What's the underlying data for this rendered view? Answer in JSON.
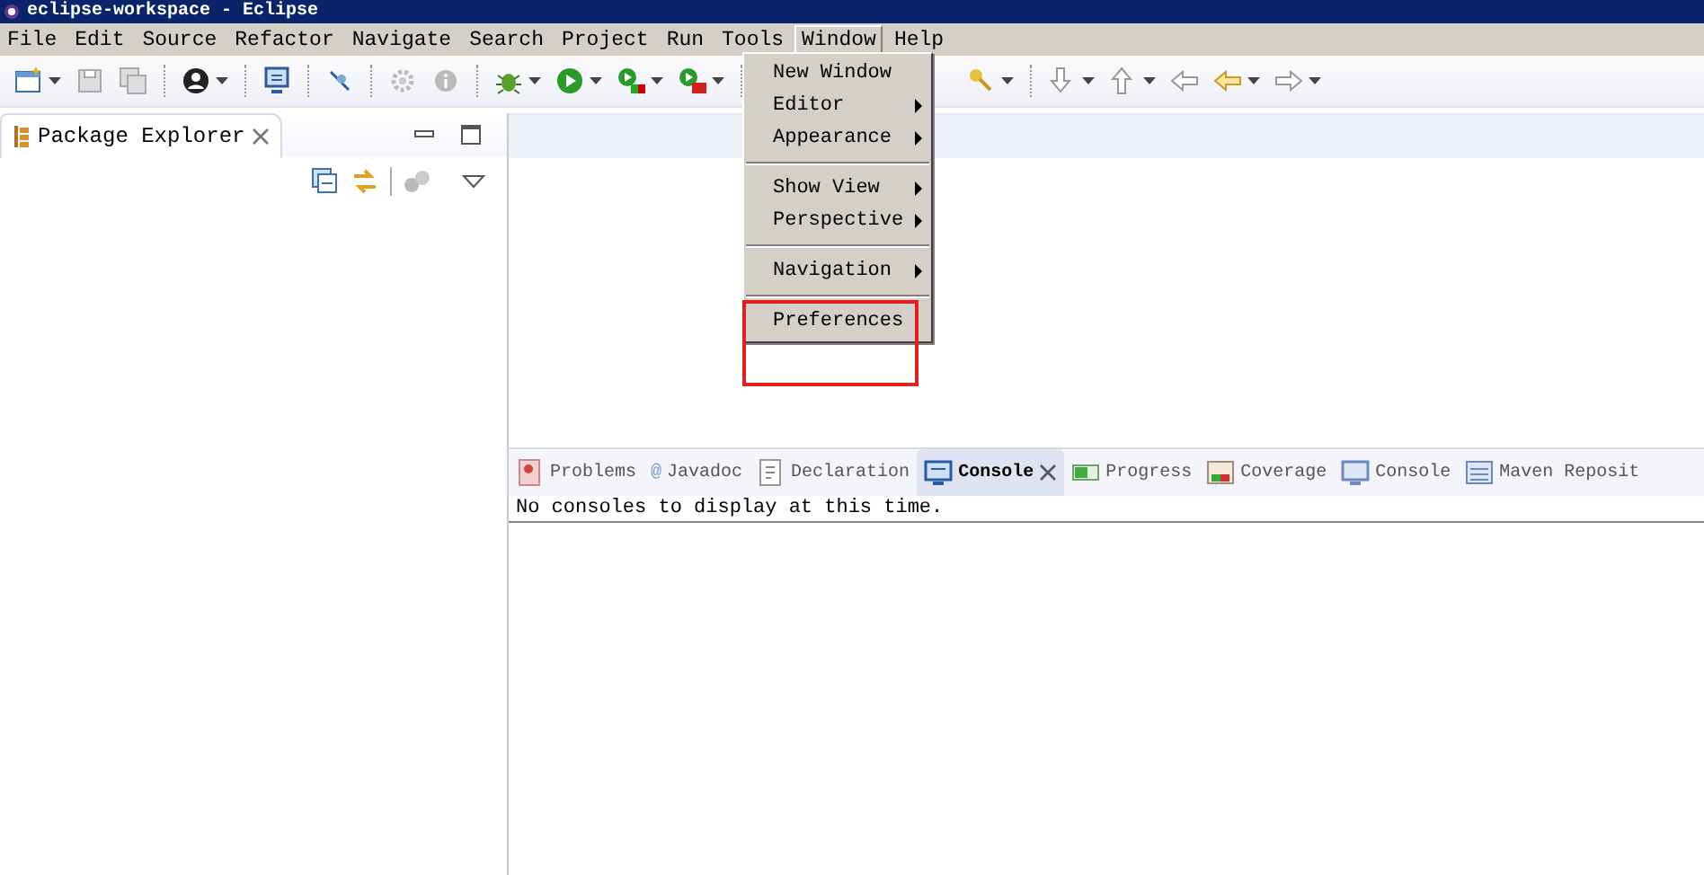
{
  "window": {
    "title": "eclipse-workspace - Eclipse"
  },
  "menu_bar": [
    {
      "label": "File",
      "selected": false
    },
    {
      "label": "Edit",
      "selected": false
    },
    {
      "label": "Source",
      "selected": false
    },
    {
      "label": "Refactor",
      "selected": false
    },
    {
      "label": "Navigate",
      "selected": false
    },
    {
      "label": "Search",
      "selected": false
    },
    {
      "label": "Project",
      "selected": false
    },
    {
      "label": "Run",
      "selected": false
    },
    {
      "label": "Tools",
      "selected": false
    },
    {
      "label": "Window",
      "selected": true
    },
    {
      "label": "Help",
      "selected": false
    }
  ],
  "window_menu": {
    "groups": [
      [
        {
          "label": "New Window",
          "submenu": false,
          "highlighted": false
        },
        {
          "label": "Editor",
          "submenu": true,
          "highlighted": false
        },
        {
          "label": "Appearance",
          "submenu": true,
          "highlighted": false
        }
      ],
      [
        {
          "label": "Show View",
          "submenu": true,
          "highlighted": false
        },
        {
          "label": "Perspective",
          "submenu": true,
          "highlighted": false
        }
      ],
      [
        {
          "label": "Navigation",
          "submenu": true,
          "highlighted": false
        }
      ],
      [
        {
          "label": "Preferences",
          "submenu": false,
          "highlighted": true
        }
      ]
    ]
  },
  "package_explorer": {
    "title": "Package Explorer"
  },
  "bottom_panel": {
    "tabs": [
      {
        "label": "Problems",
        "selected": false,
        "closable": false
      },
      {
        "label": "Javadoc",
        "icon_text": "@",
        "selected": false,
        "closable": false
      },
      {
        "label": "Declaration",
        "selected": false,
        "closable": false
      },
      {
        "label": "Console",
        "selected": true,
        "closable": true
      },
      {
        "label": "Progress",
        "selected": false,
        "closable": false
      },
      {
        "label": "Coverage",
        "selected": false,
        "closable": false
      },
      {
        "label": "Console",
        "selected": false,
        "closable": false
      },
      {
        "label": "Maven Reposit",
        "selected": false,
        "closable": false
      }
    ],
    "message": "No consoles to display at this time."
  }
}
